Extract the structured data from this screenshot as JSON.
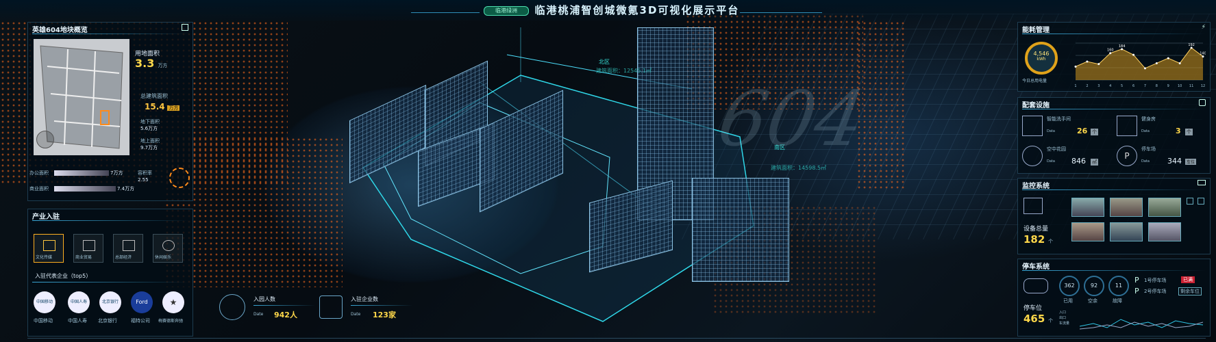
{
  "header": {
    "logo_text": "临港绿洲",
    "title": "临港桃浦智创城微氪3D可视化展示平台"
  },
  "overview": {
    "title": "英雄604地块概览",
    "land_area_label": "用地面积",
    "land_area_value": "3.3",
    "land_area_unit": "万方",
    "build_area_label": "总建筑面积",
    "build_area_value": "15.4",
    "build_area_unit": "万方",
    "under_label": "地下面积",
    "under_value": "5.6万方",
    "above_label": "地上面积",
    "above_value": "9.7万方",
    "office_label": "办公面积",
    "office_value": "7万方",
    "commerce_label": "商业面积",
    "commerce_value": "7.4万方",
    "ratio_label": "容积率",
    "ratio_value": "2.55"
  },
  "industry": {
    "title": "产业入驻",
    "cats": [
      "文化传媒",
      "商业贸易",
      "总部经济",
      "休闲娱乐"
    ],
    "rep_title": "入驻代表企业（top5）",
    "companies": [
      {
        "logo": "中国移动",
        "name": "中国移动"
      },
      {
        "logo": "中国人寿",
        "name": "中国人寿"
      },
      {
        "logo": "北京银行",
        "name": "北京银行"
      },
      {
        "logo": "Ford",
        "name": "福特公司"
      },
      {
        "logo": "★",
        "name": "梅赛德斯奔驰"
      }
    ]
  },
  "stats": {
    "people_label": "入园人数",
    "people_date": "Date",
    "people_value": "942人",
    "company_label": "入驻企业数",
    "company_date": "Date",
    "company_value": "123家"
  },
  "scene": {
    "north": "北区",
    "south": "南区",
    "north_area": "建筑面积：12545.1㎡",
    "south_area": "建筑面积：14598.5㎡",
    "block": "604"
  },
  "energy": {
    "title": "能耗管理",
    "gauge_value": "4,546",
    "gauge_unit": "kWh",
    "gauge_label": "今日总用电量",
    "chart_data": {
      "type": "area",
      "x": [
        1,
        2,
        3,
        4,
        5,
        6,
        7,
        8,
        9,
        10,
        11,
        12
      ],
      "values": [
        80,
        110,
        95,
        160,
        184,
        150,
        70,
        100,
        130,
        100,
        192,
        140
      ],
      "labels": [
        {
          "x": 4,
          "text": "160"
        },
        {
          "x": 5,
          "text": "184"
        },
        {
          "x": 11,
          "text": "192"
        },
        {
          "x": 12,
          "text": "140"
        }
      ],
      "ylim": [
        0,
        220
      ]
    }
  },
  "facilities": {
    "title": "配套设施",
    "items": [
      {
        "label": "智能洗手间",
        "sub": "Data",
        "value": "26",
        "unit": "个"
      },
      {
        "label": "健身房",
        "sub": "Data",
        "value": "3",
        "unit": "个"
      },
      {
        "label": "空中花园",
        "sub": "Data",
        "value": "846",
        "unit": "㎡"
      },
      {
        "label": "停车场",
        "sub": "Data",
        "value": "344",
        "unit": "车位"
      }
    ]
  },
  "monitor": {
    "title": "监控系统",
    "total_label": "设备总量",
    "total_value": "182",
    "total_unit": "个"
  },
  "parking": {
    "title": "停车系统",
    "spots_label": "停车位",
    "spots_value": "465",
    "spots_unit": "个",
    "c1": "362",
    "c1_label": "已用",
    "c2": "92",
    "c2_label": "空余",
    "c3": "11",
    "c3_label": "故障",
    "lot1": "1号停车场",
    "lot1_badge": "已满",
    "lot2": "2号停车场",
    "lot2_badge": "剩余车位",
    "legend1": "入口",
    "legend2": "出口",
    "legend3": "车流量"
  }
}
